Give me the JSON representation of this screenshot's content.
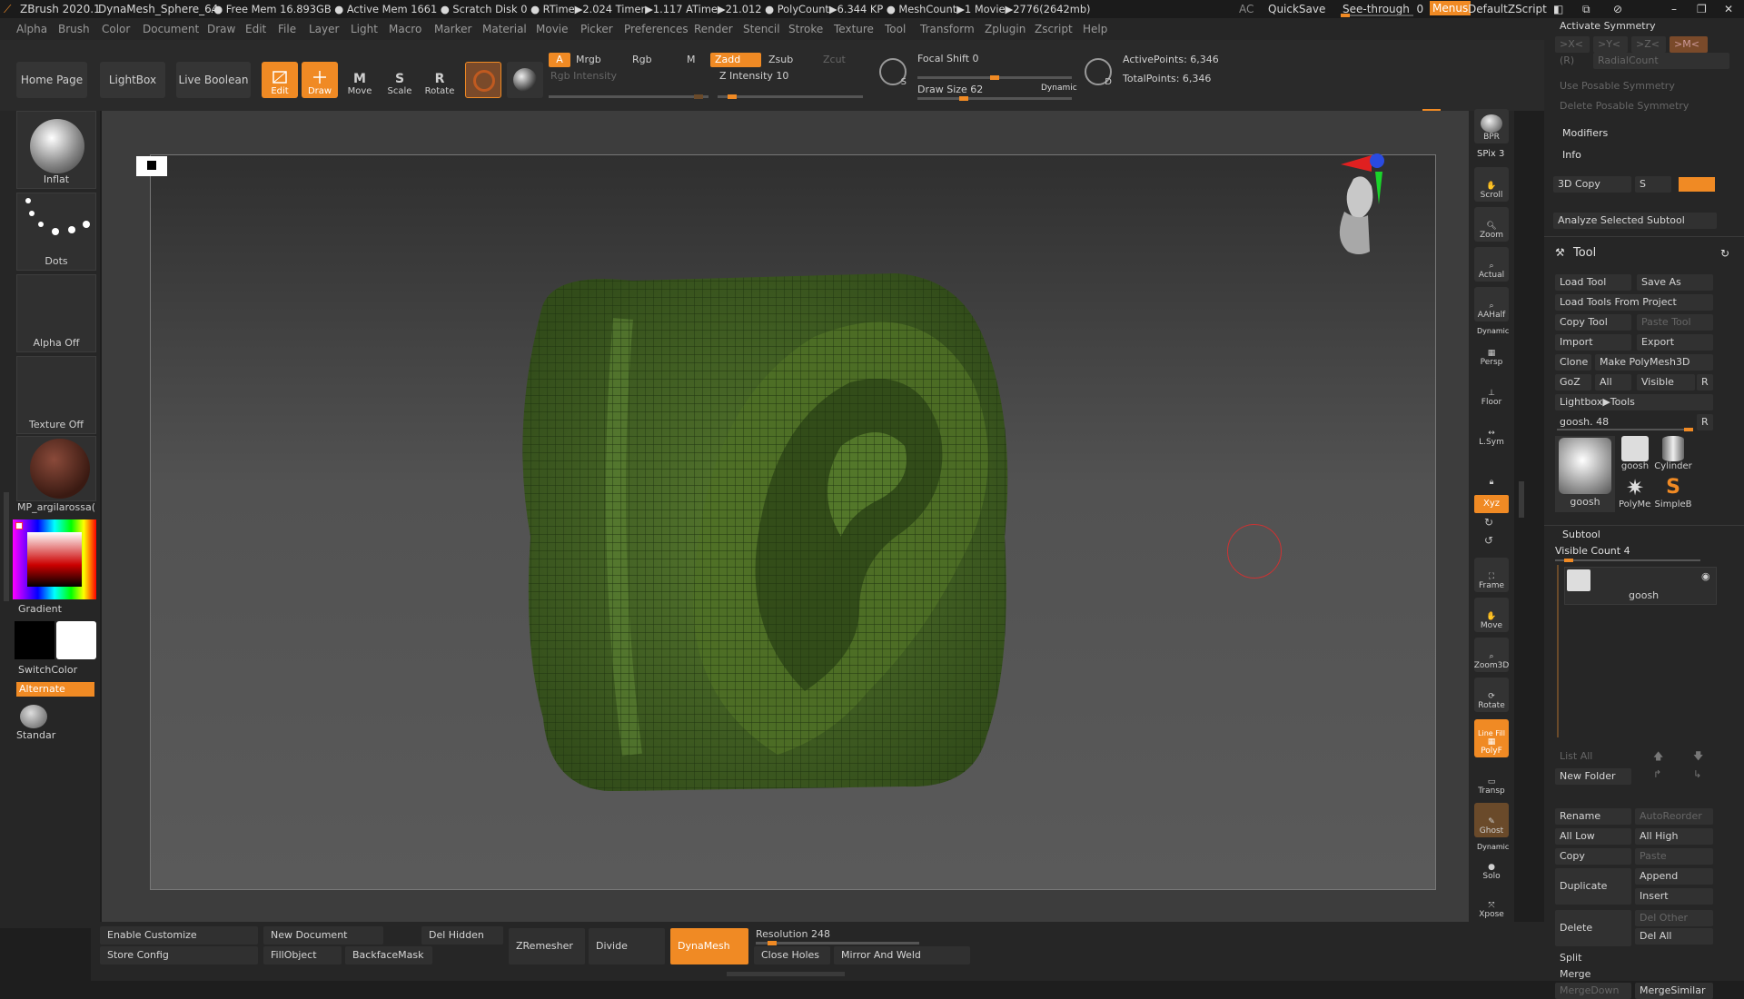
{
  "titlebar": {
    "app": "ZBrush 2020.1",
    "document": "DynaMesh_Sphere_64",
    "stats": "..● Free Mem 16.893GB ● Active Mem 1661 ● Scratch Disk 0 ● RTime▶2.024 Timer▶1.117 ATime▶21.012 ● PolyCount▶6.344 KP ● MeshCount▶1 Movie▶2776(2642mb)",
    "ac": "AC",
    "quicksave": "QuickSave",
    "seethrough": "See-through",
    "seethrough_value": "0",
    "menus": "Menus",
    "zscript": "DefaultZScript"
  },
  "menubar": [
    "Alpha",
    "Brush",
    "Color",
    "Document",
    "Draw",
    "Edit",
    "File",
    "Layer",
    "Light",
    "Macro",
    "Marker",
    "Material",
    "Movie",
    "Picker",
    "Preferences",
    "Render",
    "Stencil",
    "Stroke",
    "Texture",
    "Tool",
    "Transform",
    "Zplugin",
    "Zscript",
    "Help"
  ],
  "toolbar": {
    "home_page": "Home Page",
    "lightbox": "LightBox",
    "live_boolean": "Live Boolean",
    "edit": "Edit",
    "draw": "Draw",
    "move": "Move",
    "scale": "Scale",
    "rotate": "Rotate",
    "a": "A",
    "mrgb": "Mrgb",
    "rgb": "Rgb",
    "m": "M",
    "zadd": "Zadd",
    "zsub": "Zsub",
    "zcut": "Zcut",
    "rgb_intensity": "Rgb Intensity",
    "z_intensity": "Z Intensity 10",
    "focal_shift": "Focal Shift 0",
    "draw_size": "Draw Size 62",
    "dynamic": "Dynamic",
    "active_points": "ActivePoints: 6,346",
    "total_points": "TotalPoints: 6,346",
    "z_intensity_level": 0.1,
    "focal_shift_level": 0.5,
    "draw_size_level": 0.3
  },
  "leftshelf": {
    "brush": "Inflat",
    "stroke": "Dots",
    "alpha": "Alpha Off",
    "texture": "Texture Off",
    "material": "MP_argilarossa(",
    "gradient": "Gradient",
    "switchcolor": "SwitchColor",
    "alternate": "Alternate",
    "standard": "Standar"
  },
  "rightshelf": [
    "BPR",
    "SPix 3",
    "Scroll",
    "Zoom",
    "Actual",
    "AAHalf",
    "Persp",
    "Floor",
    "L.Sym",
    "",
    "Xyz",
    "",
    "Frame",
    "Move",
    "Zoom3D",
    "Rotate",
    "PolyF",
    "Transp",
    "Ghost",
    "Solo",
    "Xpose"
  ],
  "rightshelf_dynamic": "Dynamic",
  "rightshelf_dynamic2": "Dynamic",
  "rightshelf_linefill": "Line Fill",
  "rpanel": {
    "activate_symmetry": "Activate Symmetry",
    "x": ">X<",
    "y": ">Y<",
    "z": ">Z<",
    "m": ">M<",
    "r": "(R)",
    "radialcount": "RadialCount",
    "use_posable": "Use Posable Symmetry",
    "delete_posable": "Delete Posable Symmetry",
    "modifiers": "Modifiers",
    "info": "Info",
    "copy3d": "3D Copy",
    "s": "S",
    "analyze": "Analyze Selected Subtool",
    "tool_title": "Tool",
    "load_tool": "Load Tool",
    "save_as": "Save As",
    "load_from_project": "Load Tools From Project",
    "copy_tool": "Copy Tool",
    "paste_tool": "Paste Tool",
    "import": "Import",
    "export": "Export",
    "clone": "Clone",
    "make_polymesh": "Make PolyMesh3D",
    "goz": "GoZ",
    "all": "All",
    "visible": "Visible",
    "r2": "R",
    "lightbox_tools": "Lightbox▶Tools",
    "goosh48": "goosh. 48",
    "r3": "R",
    "thumb_goosh_big": "goosh",
    "thumb_goosh": "goosh",
    "thumb_cylinder": "Cylinder",
    "thumb_polymesh": "PolyMes",
    "thumb_simpleb": "SimpleB",
    "subtool": "Subtool",
    "visible_count": "Visible Count 4",
    "subtool_name": "goosh",
    "list_all": "List All",
    "new_folder": "New Folder",
    "rename": "Rename",
    "autoreorder": "AutoReorder",
    "all_low": "All Low",
    "all_high": "All High",
    "copy": "Copy",
    "paste": "Paste",
    "duplicate": "Duplicate",
    "append": "Append",
    "insert": "Insert",
    "delete": "Delete",
    "del_other": "Del Other",
    "del_all": "Del All",
    "split": "Split",
    "merge": "Merge",
    "merge_down": "MergeDown",
    "merge_similar": "MergeSimilar"
  },
  "bottombar": {
    "enable_customize": "Enable Customize",
    "store_config": "Store Config",
    "new_document": "New Document",
    "fillobject": "FillObject",
    "backfacemask": "BackfaceMask",
    "del_hidden": "Del Hidden",
    "zremesher": "ZRemesher",
    "divide": "Divide",
    "dynamesh": "DynaMesh",
    "resolution": "Resolution 248",
    "close_holes": "Close Holes",
    "mirror_weld": "Mirror And Weld",
    "resolution_level": 0.1
  },
  "colors": {
    "accent": "#f08a24",
    "mesh_green": "#4a6a28",
    "mesh_dark": "#2f4618"
  }
}
